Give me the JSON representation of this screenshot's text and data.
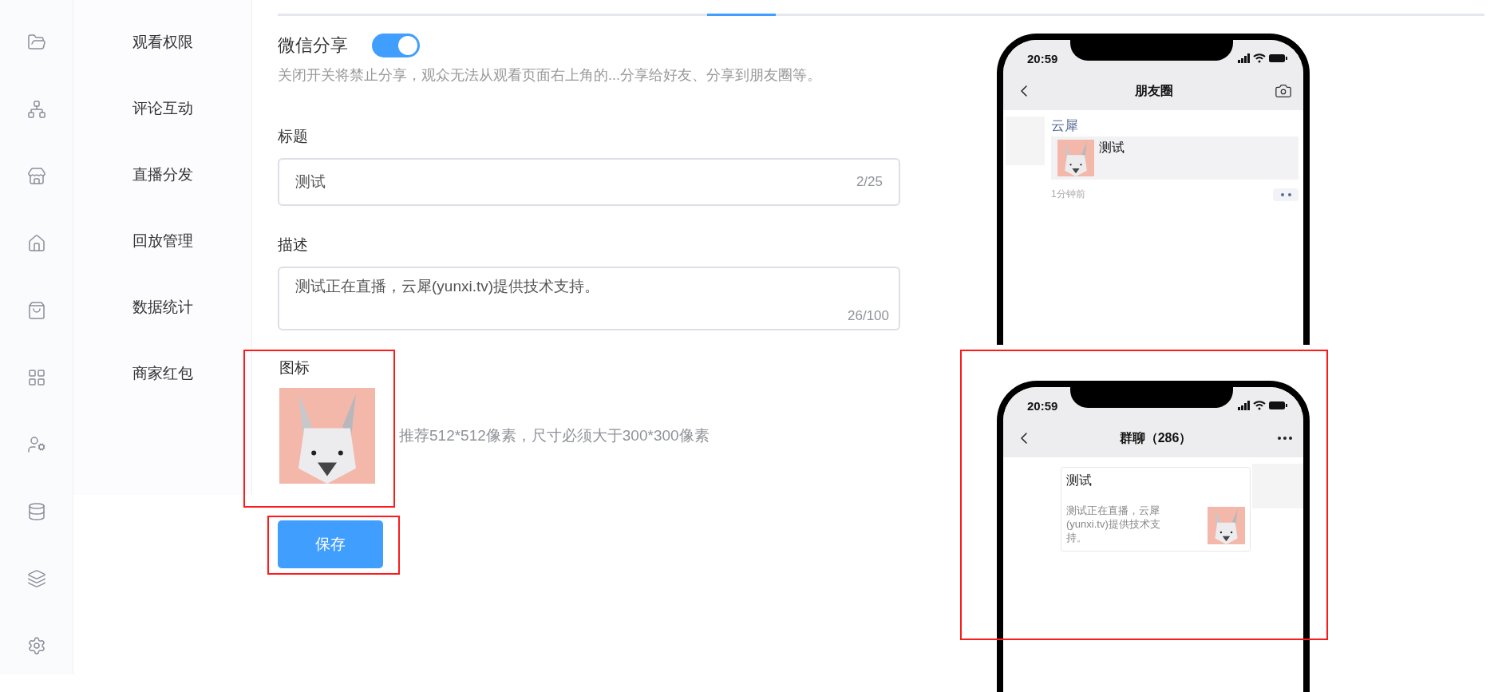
{
  "nav": [
    {
      "label": "观看权限",
      "selected": false
    },
    {
      "label": "评论互动",
      "selected": false
    },
    {
      "label": "直播分发",
      "selected": false
    },
    {
      "label": "回放管理",
      "selected": false
    },
    {
      "label": "数据统计",
      "selected": false
    },
    {
      "label": "商家红包",
      "selected": false
    }
  ],
  "tabs": [
    {
      "selected": false
    },
    {
      "selected": true
    },
    {
      "selected": false
    }
  ],
  "share": {
    "label": "微信分享",
    "on": true,
    "hint": "关闭开关将禁止分享，观众无法从观看页面右上角的...分享给好友、分享到朋友圈等。"
  },
  "form": {
    "title": {
      "label": "标题",
      "value": "测试",
      "count": "2/25"
    },
    "description": {
      "label": "描述",
      "value": "测试正在直播，云犀(yunxi.tv)提供技术支持。",
      "count": "26/100"
    },
    "icon": {
      "label": "图标",
      "hint": "推荐512*512像素，尺寸必须大于300*300像素"
    }
  },
  "save_button": "保存",
  "previews": [
    {
      "kind": "moments",
      "time": "20:59",
      "title": "朋友圈",
      "author": "云犀",
      "post_text": "测试",
      "ago": "1分钟前"
    },
    {
      "kind": "group_chat",
      "time": "20:59",
      "title": "群聊（286）",
      "card_title": "测试",
      "card_text": "测试正在直播，云犀(yunxi.tv)提供技术支持。"
    }
  ]
}
